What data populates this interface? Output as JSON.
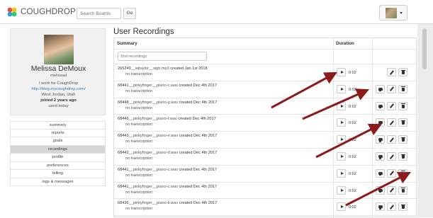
{
  "app": {
    "logo_text": "COUGHDROP",
    "search_placeholder": "Search Boards",
    "go_label": "Go"
  },
  "profile": {
    "name": "Melissa DeMoux",
    "username": "melissad",
    "bio": "I work for CoughDrop",
    "link": "http://blog.mycoughdrop.com/",
    "location": "West Jordan, Utah",
    "joined": "joined 2 years ago",
    "used": "used today"
  },
  "menu": [
    {
      "label": "summary",
      "active": false
    },
    {
      "label": "reports",
      "active": false
    },
    {
      "label": "goals",
      "active": false
    },
    {
      "label": "recordings",
      "active": true
    },
    {
      "label": "profile",
      "active": false
    },
    {
      "label": "preferences",
      "active": false
    },
    {
      "label": "billing",
      "active": false
    },
    {
      "label": "logs & messages",
      "active": false
    }
  ],
  "main": {
    "title": "User Recordings",
    "col_summary": "Summary",
    "col_duration": "Duration",
    "find_placeholder": "find recordings"
  },
  "recordings": [
    {
      "id": "265249",
      "file": "__wjtaylor__sigh.mp3",
      "created": "created Jan 1st 2018",
      "transcription": "no transcription",
      "duration": "0:02",
      "has_extra": false
    },
    {
      "id": "68441",
      "file": "__pinkyfinger__piano-c.wav",
      "created": "created Dec 4th 2017",
      "transcription": "no transcription",
      "duration": "0:02",
      "has_extra": true
    },
    {
      "id": "68448",
      "file": "__pinkyfinger__piano-g.wav",
      "created": "created Dec 4th 2017",
      "transcription": "no transcription",
      "duration": "0:02",
      "has_extra": true
    },
    {
      "id": "68446",
      "file": "__pinkyfinger__piano-f.wav",
      "created": "created Dec 4th 2017",
      "transcription": "no transcription",
      "duration": "0:02",
      "has_extra": true
    },
    {
      "id": "68443",
      "file": "__pinkyfinger__piano-e.wav",
      "created": "created Dec 4th 2017",
      "transcription": "no transcription",
      "duration": "0:02",
      "has_extra": true
    },
    {
      "id": "68442",
      "file": "__pinkyfinger__piano-d.wav",
      "created": "created Dec 4th 2017",
      "transcription": "no transcription",
      "duration": "0:02",
      "has_extra": true
    },
    {
      "id": "68441",
      "file": "__pinkyfinger__piano-c.wav",
      "created": "created Dec 4th 2017",
      "transcription": "no transcription",
      "duration": "0:02",
      "has_extra": true
    },
    {
      "id": "68441",
      "file": "__pinkyfinger__piano-c.wav",
      "created": "created Dec 4th 2017",
      "transcription": "no transcription",
      "duration": "0:02",
      "has_extra": true
    },
    {
      "id": "68436",
      "file": "__pinkyfinger__piano-b.wav",
      "created": "created Dec 4th 2017",
      "transcription": "no transcription",
      "duration": "0:02",
      "has_extra": true
    }
  ],
  "annotation_color": "#8b1a1a"
}
